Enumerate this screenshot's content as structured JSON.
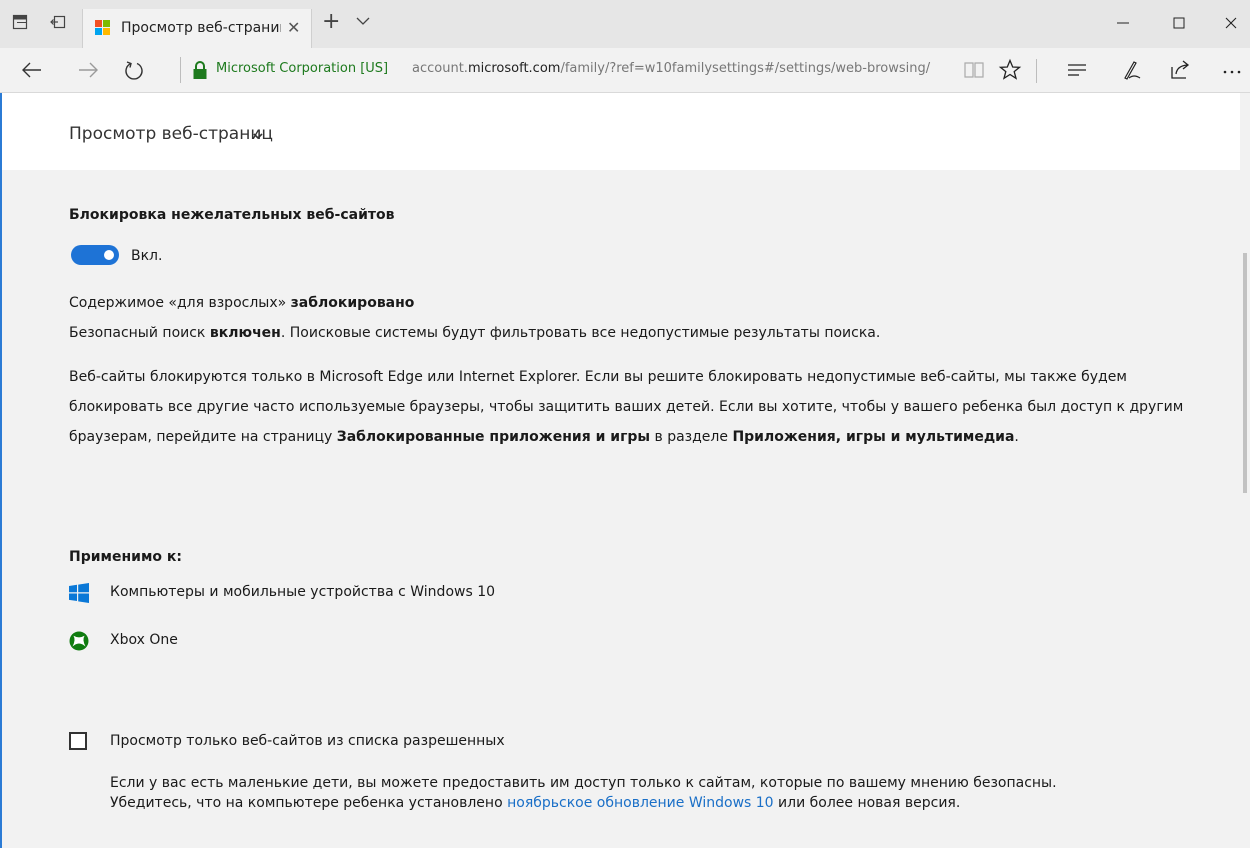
{
  "browser": {
    "tab_title": "Просмотр веб-страниц",
    "tab_close": "✕",
    "new_tab": "+",
    "site_identity": "Microsoft Corporation [US]",
    "url_prefix": "account.",
    "url_domain": "microsoft.com",
    "url_path": "/family/?ref=w10familysettings#/settings/web-browsing/"
  },
  "header": {
    "section_title": "Просмотр веб-страниц"
  },
  "block": {
    "heading": "Блокировка нежелательных веб-сайтов",
    "toggle_label": "Вкл.",
    "toggle_on": true
  },
  "adult": {
    "prefix": "Содержимое «для взрослых» ",
    "status": "заблокировано"
  },
  "safe_search": {
    "prefix": "Безопасный поиск ",
    "status": "включен",
    "suffix": ". Поисковые системы будут фильтровать все недопустимые результаты поиска."
  },
  "description": {
    "part1": "Веб-сайты блокируются только в Microsoft Edge или Internet Explorer. Если вы решите блокировать недопустимые веб-сайты, мы также будем блокировать все другие часто используемые браузеры, чтобы защитить ваших детей. Если вы хотите, чтобы у вашего ребенка был доступ к другим браузерам, перейдите на страницу ",
    "bold1": "Заблокированные приложения и игры",
    "part2": " в разделе ",
    "bold2": "Приложения, игры и мультимедиа",
    "part3": "."
  },
  "applies_to": {
    "heading": "Применимо к:",
    "devices": [
      {
        "label": "Компьютеры и мобильные устройства с Windows 10",
        "icon": "windows-logo-icon"
      },
      {
        "label": "Xbox One",
        "icon": "xbox-logo-icon"
      }
    ]
  },
  "allow_list": {
    "checked": false,
    "label": "Просмотр только веб-сайтов из списка разрешенных",
    "desc_line1": "Если у вас есть маленькие дети, вы можете предоставить им доступ только к сайтам, которые по вашему мнению безопасны.",
    "desc_line2_prefix": "Убедитесь, что на компьютере ребенка установлено ",
    "desc_link": "ноябрьское обновление Windows 10",
    "desc_line2_suffix": " или более новая версия."
  },
  "colors": {
    "accent": "#1e73d6",
    "link": "#1a6fc7",
    "secure_green": "#1e7a1e",
    "xbox_green": "#107c10"
  }
}
